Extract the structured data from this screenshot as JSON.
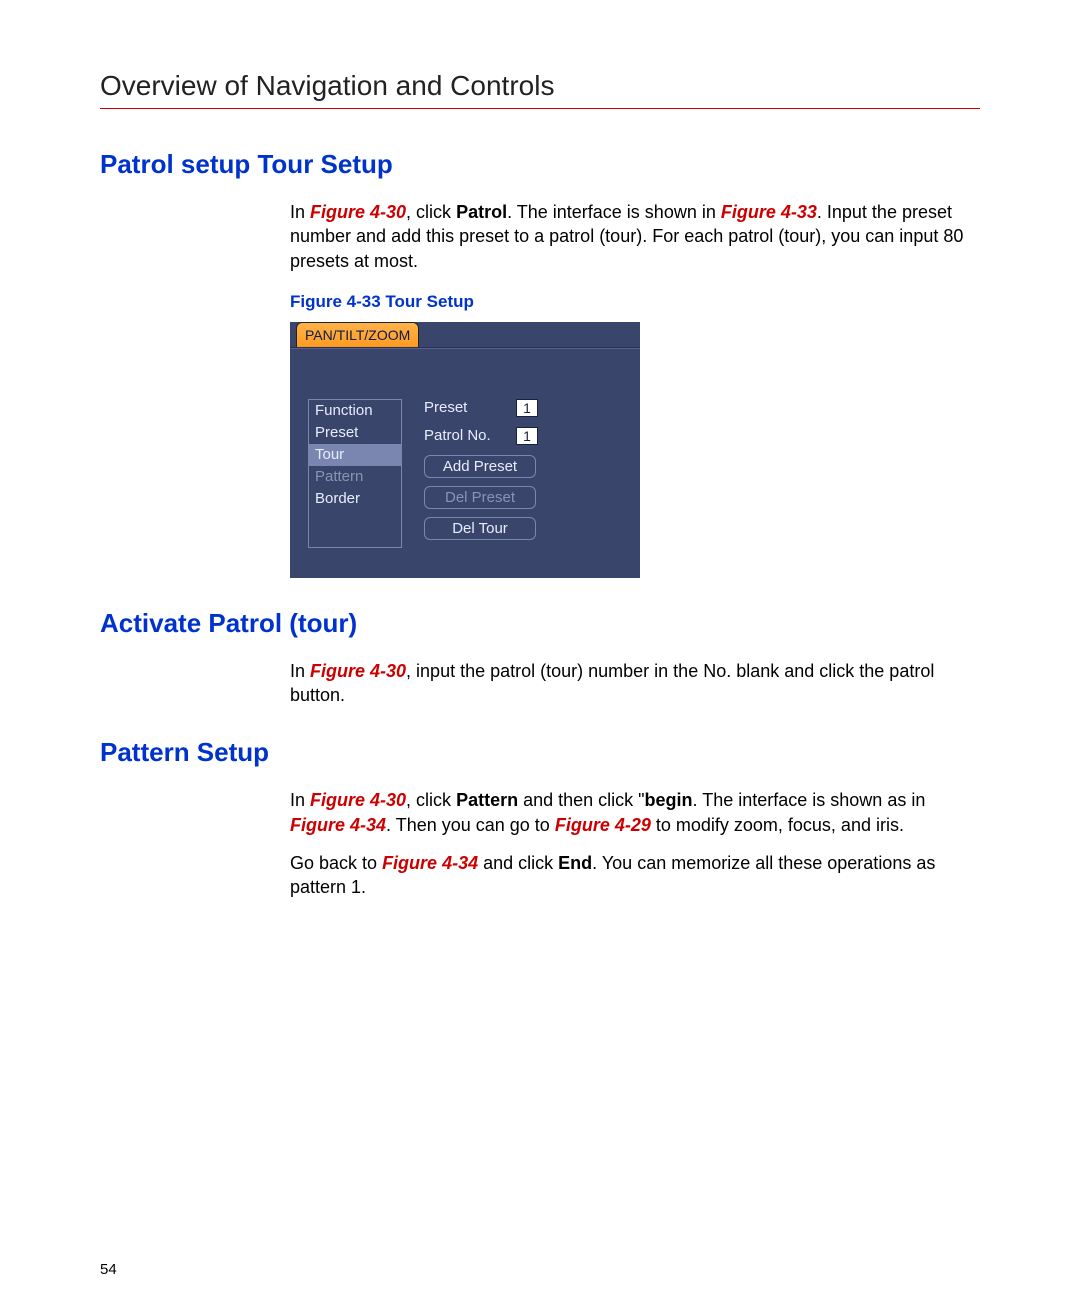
{
  "pageTitle": "Overview of Navigation and Controls",
  "pageNumber": "54",
  "sections": {
    "patrolSetup": {
      "heading": "Patrol setup Tour Setup",
      "p1_pre": "In ",
      "p1_ref1": "Figure 4-30",
      "p1_mid1": ", click ",
      "p1_bold1": "Patrol",
      "p1_mid2": ". The interface is shown in ",
      "p1_ref2": "Figure 4-33",
      "p1_post": ". Input the preset number and add this preset to a patrol (tour). For each patrol (tour), you can input 80 presets at most.",
      "figureCaption": "Figure 4-33 Tour Setup"
    },
    "activatePatrol": {
      "heading": "Activate Patrol (tour)",
      "p1_pre": "In ",
      "p1_ref1": "Figure 4-30",
      "p1_post": ", input the patrol (tour) number in the No. blank and click the patrol button."
    },
    "patternSetup": {
      "heading": "Pattern Setup",
      "p1_pre": "In ",
      "p1_ref1": "Figure 4-30",
      "p1_mid1": ", click ",
      "p1_bold1": "Pattern",
      "p1_mid2": " and then click \"",
      "p1_bold2": "begin",
      "p1_mid3": ". The interface is shown as in ",
      "p1_ref2": "Figure 4-34",
      "p1_mid4": ". Then you can go to ",
      "p1_ref3": "Figure 4-29",
      "p1_post": " to modify zoom, focus, and iris.",
      "p2_pre": "Go back to ",
      "p2_ref1": "Figure 4-34",
      "p2_mid1": " and click ",
      "p2_bold1": "End",
      "p2_post": ". You can memorize all these operations as pattern 1."
    }
  },
  "ptz": {
    "tab": "PAN/TILT/ZOOM",
    "functions": [
      "Function",
      "Preset",
      "Tour",
      "Pattern",
      "Border"
    ],
    "selectedIndex": 2,
    "dimIndex": 3,
    "presetLabel": "Preset",
    "presetValue": "1",
    "patrolLabel": "Patrol No.",
    "patrolValue": "1",
    "buttons": {
      "addPreset": "Add Preset",
      "delPreset": "Del Preset",
      "delTour": "Del Tour"
    }
  }
}
